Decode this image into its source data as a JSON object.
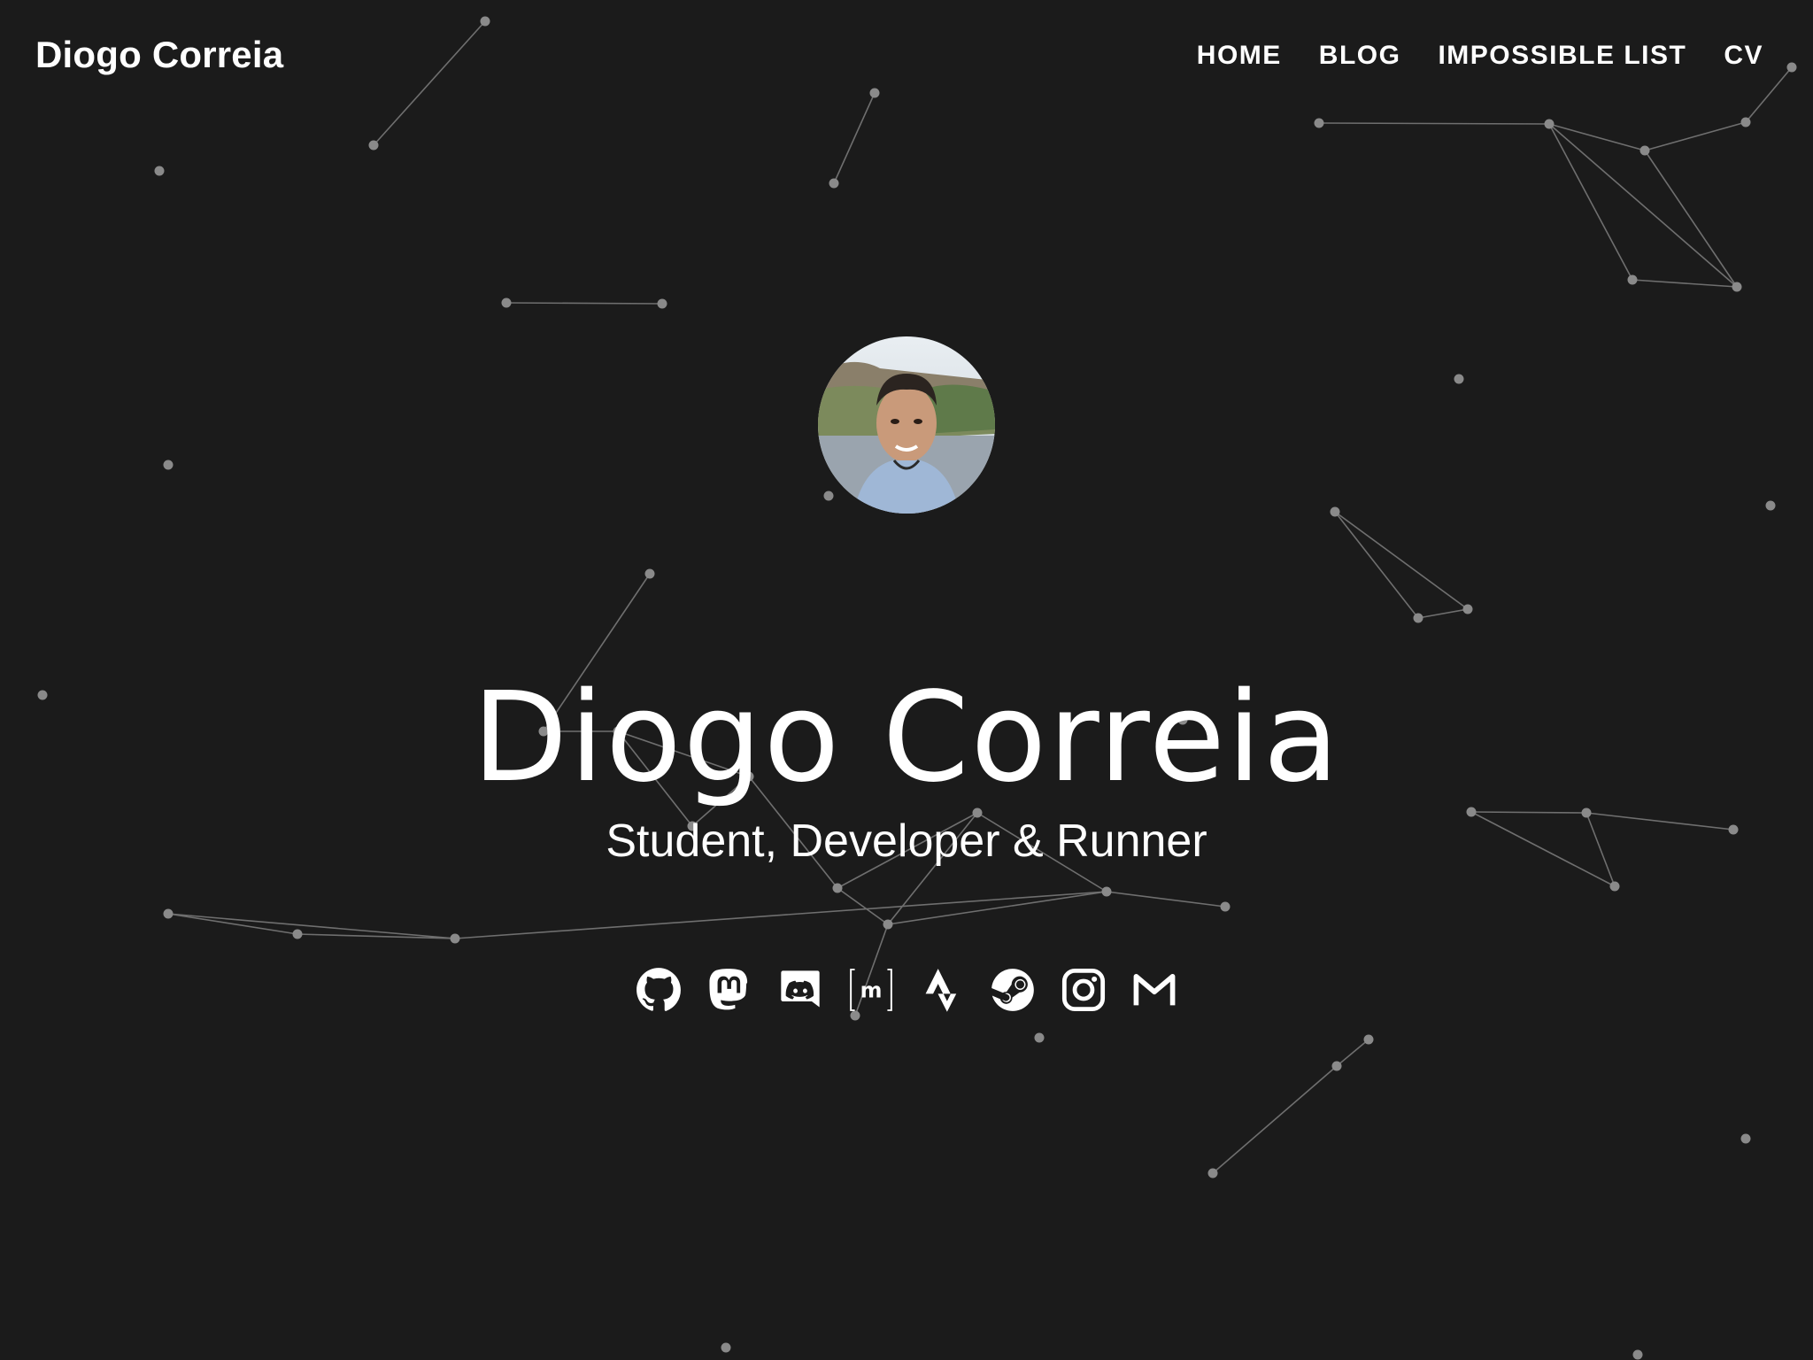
{
  "site": {
    "brand": "Diogo Correia"
  },
  "nav": {
    "items": [
      {
        "label": "HOME"
      },
      {
        "label": "BLOG"
      },
      {
        "label": "IMPOSSIBLE LIST"
      },
      {
        "label": "CV"
      }
    ]
  },
  "hero": {
    "name": "Diogo Correia",
    "tagline": "Student, Developer & Runner"
  },
  "socials": [
    {
      "icon": "github-icon"
    },
    {
      "icon": "mastodon-icon"
    },
    {
      "icon": "discord-icon"
    },
    {
      "icon": "matrix-icon"
    },
    {
      "icon": "strava-icon"
    },
    {
      "icon": "steam-icon"
    },
    {
      "icon": "instagram-icon"
    },
    {
      "icon": "gmail-icon"
    }
  ],
  "colors": {
    "background": "#1b1b1b",
    "text": "#ffffff",
    "particles": "#8a8a8a"
  }
}
